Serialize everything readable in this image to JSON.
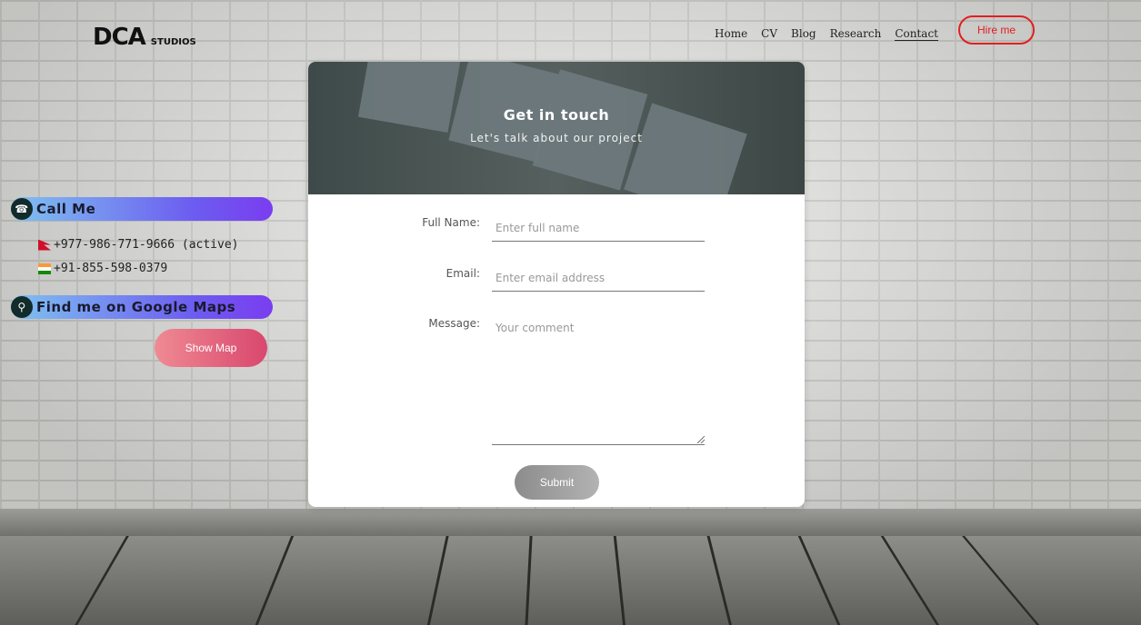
{
  "header": {
    "logo_mark": "DCA",
    "logo_sub": "STUDIOS",
    "nav": [
      "Home",
      "CV",
      "Blog",
      "Research",
      "Contact"
    ],
    "hire_label": "Hire me"
  },
  "contact_panel": {
    "call_title": "Call Me",
    "phones": [
      "+977-986-771-9666 (active)",
      "+91-855-598-0379"
    ],
    "maps_title": "Find me on Google Maps",
    "show_map_label": "Show Map"
  },
  "form": {
    "title": "Get in touch",
    "subtitle": "Let's talk about our project",
    "name_label": "Full Name:",
    "name_placeholder": "Enter full name",
    "email_label": "Email:",
    "email_placeholder": "Enter email address",
    "message_label": "Message:",
    "message_placeholder": "Your comment",
    "submit_label": "Submit"
  },
  "colors": {
    "accent_red": "#e02020",
    "pill_gradient_start": "#7fc3f0",
    "pill_gradient_end": "#7a3df0",
    "show_map_gradient": "#d9476e"
  }
}
